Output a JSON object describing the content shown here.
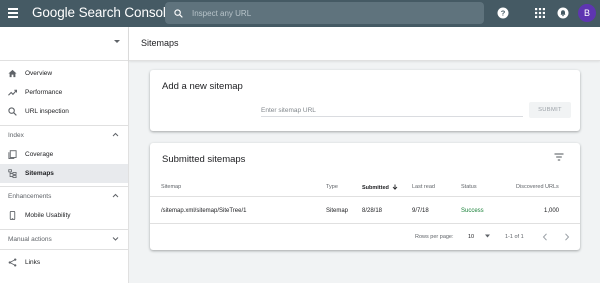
{
  "app": {
    "title": "Google Search Console"
  },
  "search": {
    "placeholder": "Inspect any URL"
  },
  "user": {
    "avatar_letter": "B"
  },
  "sidebar": {
    "top_items": [
      {
        "label": "Overview"
      },
      {
        "label": "Performance"
      },
      {
        "label": "URL inspection"
      }
    ],
    "index_section": {
      "label": "Index"
    },
    "index_items": [
      {
        "label": "Coverage"
      },
      {
        "label": "Sitemaps"
      }
    ],
    "enhancements_section": {
      "label": "Enhancements"
    },
    "enhancements_items": [
      {
        "label": "Mobile Usability"
      }
    ],
    "manual_section": {
      "label": "Manual actions"
    },
    "bottom_items": [
      {
        "label": "Links"
      }
    ]
  },
  "page": {
    "title": "Sitemaps"
  },
  "add_card": {
    "title": "Add a new sitemap",
    "input_placeholder": "Enter sitemap URL",
    "submit_label": "SUBMIT"
  },
  "submitted_card": {
    "title": "Submitted sitemaps",
    "columns": [
      "Sitemap",
      "Type",
      "Submitted",
      "Last read",
      "Status",
      "Discovered URLs"
    ],
    "rows": [
      {
        "sitemap": "/sitemap.xml/sitemap/SiteTree/1",
        "type": "Sitemap",
        "submitted": "8/28/18",
        "last_read": "9/7/18",
        "status": "Success",
        "discovered": "1,000"
      }
    ],
    "pagination": {
      "rows_per_page_label": "Rows per page:",
      "rows_per_page": "10",
      "range": "1-1 of 1"
    }
  },
  "colors": {
    "topbar": "#455a64",
    "success": "#188038",
    "avatar": "#5e35b1"
  }
}
